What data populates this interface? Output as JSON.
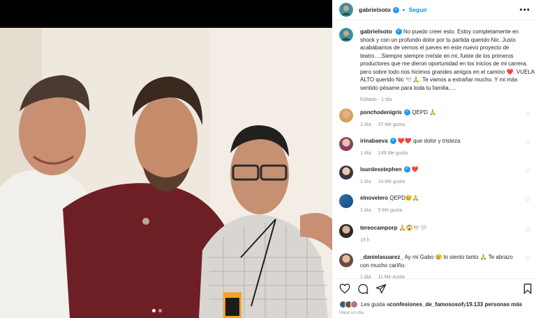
{
  "post": {
    "username": "gabrielsoto",
    "follow_label": "Seguir",
    "separator": "•",
    "caption": "No puedo creer esto. Estoy completamente en shock y con un profundo dolor por tu partida querido Nic. Justo acabábamos de vernos el jueves en este nuevo proyecto de teatro….Siempre siempre creíste en mi, fuiste de los primeros productores que me dieron oportunidad en los inicios de mi carrera. pero sobre todo nos hicimos grandes amigos en el camino ❤️. VUELA ALTO querido Nic 🕊️🙏. Te vamos a extrañar mucho. Y mi más sentido pésame para toda tu familia.....",
    "edited_label": "Editado",
    "edited_time": "1 día"
  },
  "comments": [
    {
      "username": "ponchodenigris",
      "verified": true,
      "text": "QEPD 🙏",
      "time": "1 día",
      "likes": "37 Me gusta"
    },
    {
      "username": "irinabaeva",
      "verified": true,
      "text": "❤️❤️ que dolor y tristeza",
      "time": "1 día",
      "likes": "149 Me gusta"
    },
    {
      "username": "lourdesstephen",
      "verified": true,
      "text": "❤️",
      "time": "1 día",
      "likes": "14 Me gusta"
    },
    {
      "username": "elnovelero",
      "verified": false,
      "text": "QEPD😢🙏",
      "time": "1 día",
      "likes": "5 Me gusta"
    },
    {
      "username": "tereocamporp",
      "verified": false,
      "text": "🙏😱🕊️🤍",
      "time": "19 h",
      "likes": ""
    },
    {
      "username": "_danielasuarez_",
      "verified": false,
      "text": "Ay mi Gabo 😢 lo siento tanto 🙏 Te abrazo con mucho cariño.",
      "time": "1 día",
      "likes": "11 Me gusta"
    }
  ],
  "footer": {
    "likes_prefix": "Les gusta a ",
    "likes_user": "confesiones_de_famososof",
    "likes_middle": " y ",
    "likes_count": "19.133 personas más",
    "time_ago": "Hace un día"
  },
  "icons": {
    "more": "more-icon",
    "like": "heart-icon",
    "comment": "comment-icon",
    "share": "send-icon",
    "save": "bookmark-icon"
  },
  "colors": {
    "accent": "#0095f6",
    "verified": "#1d9bf0",
    "heart": "#ed4956",
    "muted": "#8e8e8e"
  }
}
